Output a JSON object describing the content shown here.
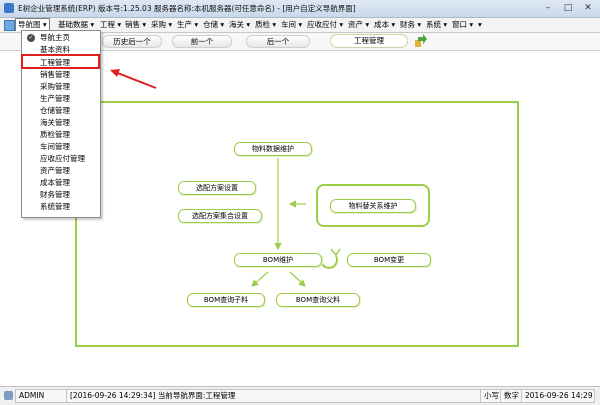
{
  "window": {
    "title": "E树企业管理系统(ERP) 版本号:1.25.03  服务器名称:本机服务器(可任意命名)  - [用户自定义导航界面]"
  },
  "menubar": {
    "items": [
      {
        "label": "导航图 ▾"
      },
      {
        "label": "基础数据 ▾"
      },
      {
        "label": "工程 ▾"
      },
      {
        "label": "销售 ▾"
      },
      {
        "label": "采购 ▾"
      },
      {
        "label": "生产 ▾"
      },
      {
        "label": "仓储 ▾"
      },
      {
        "label": "海关 ▾"
      },
      {
        "label": "质检 ▾"
      },
      {
        "label": "车间 ▾"
      },
      {
        "label": "应收应付 ▾"
      },
      {
        "label": "资产 ▾"
      },
      {
        "label": "成本 ▾"
      },
      {
        "label": "财务 ▾"
      },
      {
        "label": "系统 ▾"
      },
      {
        "label": "窗口 ▾"
      },
      {
        "label": "▾"
      }
    ]
  },
  "toolbar": {
    "history_back": "历史后一个",
    "prev": "前一个",
    "next": "后一个",
    "active_tab": "工程管理"
  },
  "dropdown": {
    "items": [
      {
        "label": "导航主页"
      },
      {
        "label": "基本资料"
      },
      {
        "label": "工程管理"
      },
      {
        "label": "销售管理"
      },
      {
        "label": "采购管理"
      },
      {
        "label": "生产管理"
      },
      {
        "label": "仓储管理"
      },
      {
        "label": "海关管理"
      },
      {
        "label": "质检管理"
      },
      {
        "label": "车间管理"
      },
      {
        "label": "应收应付管理"
      },
      {
        "label": "资产管理"
      },
      {
        "label": "成本管理"
      },
      {
        "label": "财务管理"
      },
      {
        "label": "系统管理"
      }
    ]
  },
  "diagram": {
    "material_data": "物料数据维护",
    "scheme_setup": "选配方案设置",
    "scheme_set_setup": "选配方案集合设置",
    "substitute_maint": "物料替关系维护",
    "bom_maint": "BOM维护",
    "bom_change": "BOM变更",
    "bom_query_child": "BOM查询子料",
    "bom_query_parent": "BOM查询父料"
  },
  "statusbar": {
    "user": "ADMIN",
    "log": "[2016-09-26 14:29:34] 当前导航界面:工程管理",
    "caps": "小写",
    "numlock": "数字",
    "datetime": "2016-09-26 14:29"
  },
  "colors": {
    "accent_green": "#9ccd48",
    "highlight_red": "#e02020",
    "arrow_red": "#e02020"
  }
}
